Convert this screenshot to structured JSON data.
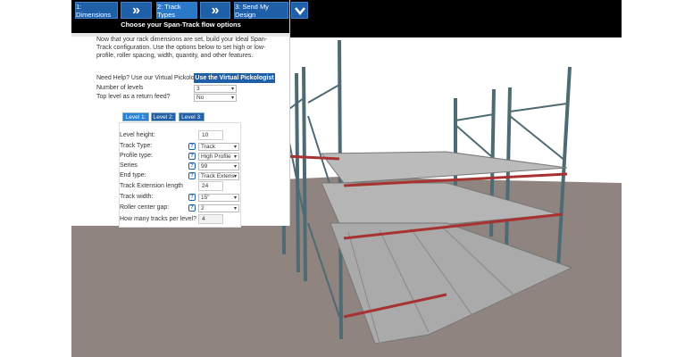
{
  "nav": {
    "step1": "1: Dimensions",
    "step2": "2: Track Types",
    "step3": "3: Send My Design",
    "next_icon": "double-chevron-right",
    "collapse_icon": "chevron-down"
  },
  "panel": {
    "title": "Choose your Span-Track flow options",
    "intro": "Now that your rack dimensions are set, build your Ideal Span-Track configuration. Use the options below to set high or low-profile, roller spacing, width, quantity, and other features.",
    "help_label": "Need Help? Use our Virtual Pickologist",
    "help_button": "Use the Virtual Pickologist",
    "levels_label": "Number of levels",
    "levels_value": "3",
    "return_label": "Top level as a return feed?",
    "return_value": "No",
    "tabs": [
      "Level 1:",
      "Level 2:",
      "Level 3:"
    ],
    "form": {
      "level_height": {
        "label": "Level height:",
        "value": "10"
      },
      "track_type": {
        "label": "Track Type:",
        "value": "Track"
      },
      "profile_type": {
        "label": "Profile type:",
        "value": "High Profile"
      },
      "series": {
        "label": "Series",
        "value": "99"
      },
      "end_type": {
        "label": "End type:",
        "value": "Track Extens"
      },
      "ext_length": {
        "label": "Track Extension length",
        "value": "24"
      },
      "track_width": {
        "label": "Track width:",
        "value": "15\""
      },
      "roller_gap": {
        "label": "Roller center gap:",
        "value": "2"
      },
      "tracks_per_level": {
        "label": "How many tracks per level?",
        "value": "4"
      },
      "help_glyph": "?"
    }
  },
  "colors": {
    "accent": "#1f5fa8",
    "rack": "#4e6b73",
    "beam": "#a83232",
    "floor": "#8f8480"
  }
}
